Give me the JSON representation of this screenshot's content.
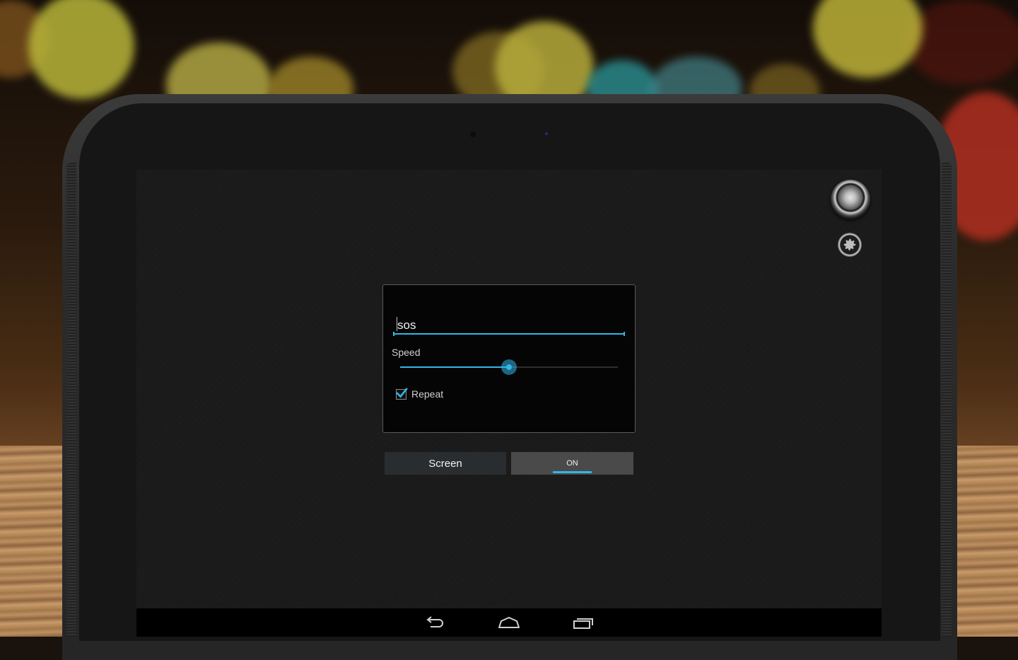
{
  "dialog": {
    "text_value": "sos",
    "speed_label": "Speed",
    "speed_fraction": 0.5,
    "repeat_label": "Repeat",
    "repeat_checked": true
  },
  "mode_buttons": {
    "screen_label": "Screen",
    "toggle_label": "ON"
  },
  "icons": {
    "power": "power-button-icon",
    "settings": "gear-icon",
    "back": "back-arrow-icon",
    "home": "home-icon",
    "recents": "recent-apps-icon"
  },
  "colors": {
    "accent": "#33b5e5",
    "panel_bg": "#050505",
    "screen_bg": "#1c1c1c"
  }
}
